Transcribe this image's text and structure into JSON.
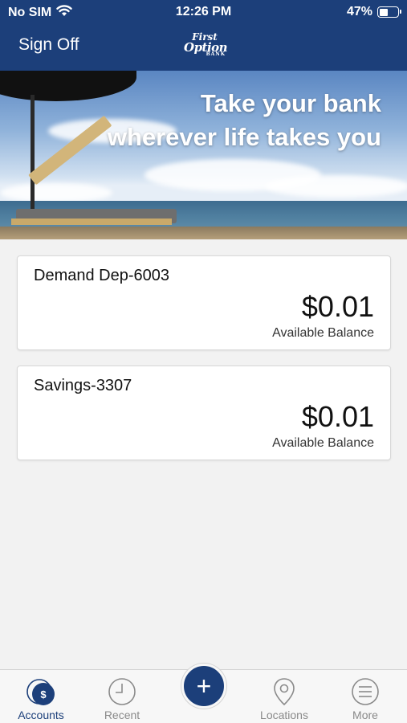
{
  "status_bar": {
    "carrier": "No SIM",
    "time": "12:26 PM",
    "battery_percent": "47%",
    "battery_level": 0.47,
    "wifi_icon": "wifi-icon"
  },
  "header": {
    "sign_off_label": "Sign Off",
    "logo": {
      "line1": "First",
      "line2": "Option",
      "line3": "BANK"
    }
  },
  "banner": {
    "headline_line1": "Take your bank",
    "headline_line2": "wherever life takes you"
  },
  "accounts": [
    {
      "name": "Demand Dep-6003",
      "amount": "$0.01",
      "balance_label": "Available Balance"
    },
    {
      "name": "Savings-3307",
      "amount": "$0.01",
      "balance_label": "Available Balance"
    }
  ],
  "tabbar": {
    "accounts": "Accounts",
    "recent": "Recent",
    "add": "+",
    "locations": "Locations",
    "more": "More",
    "active": "accounts"
  },
  "colors": {
    "brand": "#1c3f7a",
    "tab_inactive": "#8a8a8a",
    "background": "#f2f2f2"
  }
}
